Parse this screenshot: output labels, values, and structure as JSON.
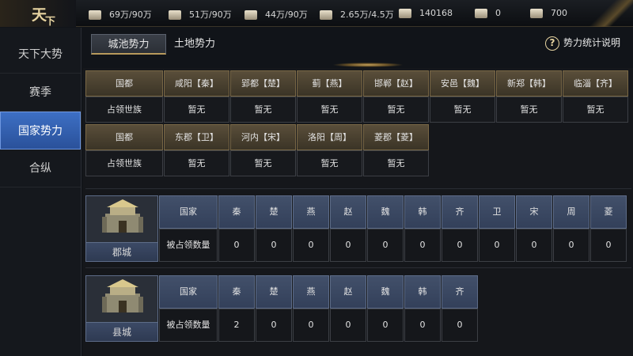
{
  "logo": {
    "text_a": "天",
    "text_b": "下"
  },
  "resources": [
    {
      "icon": "wheat-icon",
      "value": "69万/90万"
    },
    {
      "icon": "wood-icon",
      "value": "51万/90万"
    },
    {
      "icon": "stone-icon",
      "value": "44万/90万"
    },
    {
      "icon": "iron-icon",
      "value": "2.65万/4.5万"
    },
    {
      "icon": "copper-icon",
      "value": "140168"
    },
    {
      "icon": "gold-icon",
      "value": "0"
    },
    {
      "icon": "silver-icon",
      "value": "700"
    }
  ],
  "sidebar": {
    "items": [
      {
        "label": "天下大势",
        "active": false
      },
      {
        "label": "赛季",
        "active": false
      },
      {
        "label": "国家势力",
        "active": true
      },
      {
        "label": "合纵",
        "active": false
      }
    ]
  },
  "tabs": [
    {
      "label": "城池势力",
      "active": true
    },
    {
      "label": "土地势力",
      "active": false
    }
  ],
  "help_label": "势力统计说明",
  "capital_table": {
    "row_header": "国都",
    "clan_header": "占领世族",
    "row1": [
      {
        "name": "咸阳【秦】",
        "clan": "暂无"
      },
      {
        "name": "郢都【楚】",
        "clan": "暂无"
      },
      {
        "name": "蓟【燕】",
        "clan": "暂无"
      },
      {
        "name": "邯郸【赵】",
        "clan": "暂无"
      },
      {
        "name": "安邑【魏】",
        "clan": "暂无"
      },
      {
        "name": "新郑【韩】",
        "clan": "暂无"
      },
      {
        "name": "临淄【齐】",
        "clan": "暂无"
      }
    ],
    "row2": [
      {
        "name": "东郡【卫】",
        "clan": "暂无"
      },
      {
        "name": "河内【宋】",
        "clan": "暂无"
      },
      {
        "name": "洛阳【周】",
        "clan": "暂无"
      },
      {
        "name": "菱郡【菱】",
        "clan": "暂无"
      }
    ]
  },
  "commandery": {
    "label": "郡城",
    "country_header": "国家",
    "count_header": "被占领数量",
    "countries": [
      "秦",
      "楚",
      "燕",
      "赵",
      "魏",
      "韩",
      "齐",
      "卫",
      "宋",
      "周",
      "菱"
    ],
    "counts": [
      "0",
      "0",
      "0",
      "0",
      "0",
      "0",
      "0",
      "0",
      "0",
      "0",
      "0"
    ]
  },
  "county": {
    "label": "县城",
    "country_header": "国家",
    "count_header": "被占领数量",
    "countries": [
      "秦",
      "楚",
      "燕",
      "赵",
      "魏",
      "韩",
      "齐"
    ],
    "counts": [
      "2",
      "0",
      "0",
      "0",
      "0",
      "0",
      "0"
    ]
  }
}
